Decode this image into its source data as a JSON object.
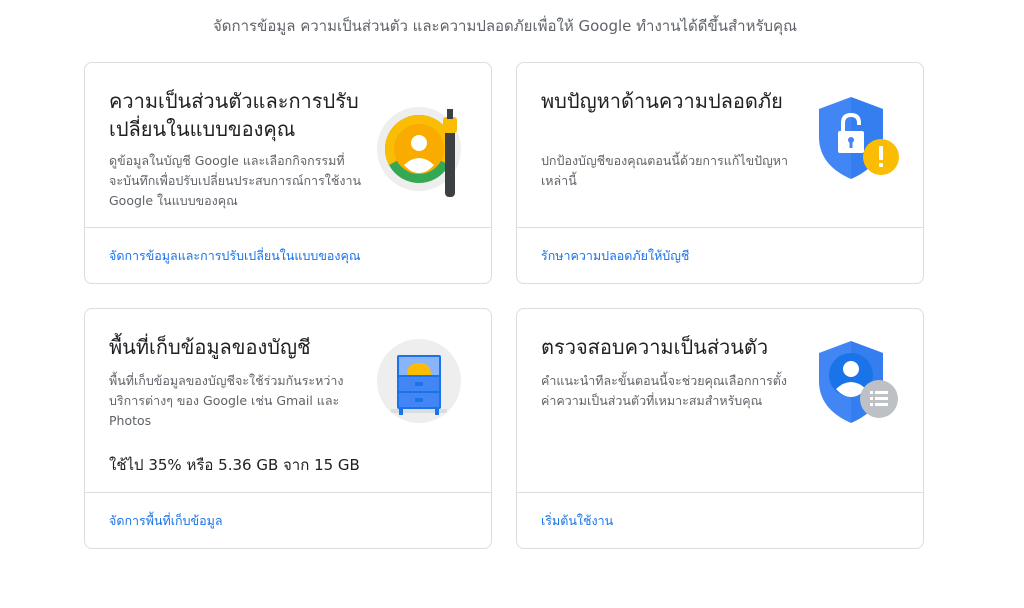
{
  "subtitle": "จัดการข้อมูล ความเป็นส่วนตัว และความปลอดภัยเพื่อให้ Google ทำงานได้ดีขึ้นสำหรับคุณ",
  "cards": [
    {
      "title": "ความเป็นส่วนตัวและการปรับเปลี่ยนในแบบของคุณ",
      "description": "ดูข้อมูลในบัญชี Google และเลือกกิจกรรมที่จะบันทึกเพื่อปรับเปลี่ยนประสบการณ์การใช้งาน Google ในแบบของคุณ",
      "link": "จัดการข้อมูลและการปรับเปลี่ยนในแบบของคุณ",
      "icon": "privacy-personalization-illustration"
    },
    {
      "title": "พบปัญหาด้านความปลอดภัย",
      "description": "ปกป้องบัญชีของคุณตอนนี้ด้วยการแก้ไขปัญหาเหล่านี้",
      "link": "รักษาความปลอดภัยให้บัญชี",
      "icon": "security-shield-warning-illustration"
    },
    {
      "title": "พื้นที่เก็บข้อมูลของบัญชี",
      "description": "พื้นที่เก็บข้อมูลของบัญชีจะใช้ร่วมกันระหว่างบริการต่างๆ ของ Google เช่น Gmail และ Photos",
      "usage": "ใช้ไป 35% หรือ 5.36 GB จาก 15 GB",
      "usage_percent": 35,
      "link": "จัดการพื้นที่เก็บข้อมูล",
      "icon": "storage-cabinet-illustration"
    },
    {
      "title": "ตรวจสอบความเป็นส่วนตัว",
      "description": "คำแนะนำทีละขั้นตอนนี้จะช่วยคุณเลือกการตั้งค่าความเป็นส่วนตัวที่เหมาะสมสำหรับคุณ",
      "link": "เริ่มต้นใช้งาน",
      "icon": "privacy-checkup-shield-illustration"
    }
  ],
  "colors": {
    "link": "#1a73e8",
    "border": "#dadce0",
    "shield_blue": "#4285f4",
    "warning_yellow": "#fbbc04"
  }
}
